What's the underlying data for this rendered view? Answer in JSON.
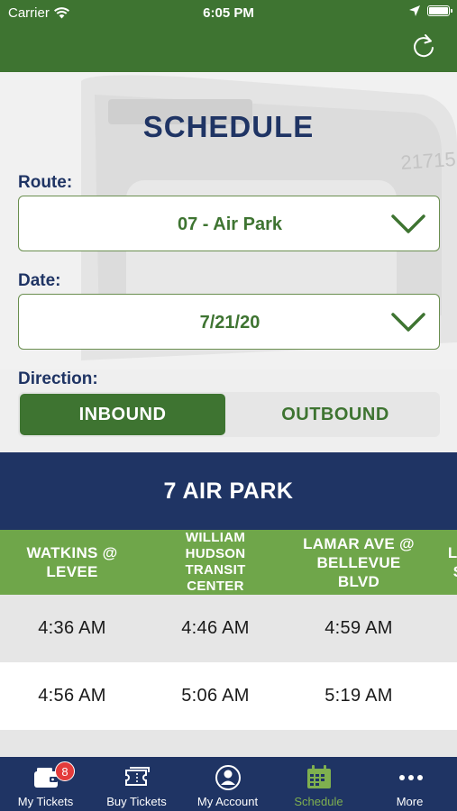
{
  "status_bar": {
    "carrier": "Carrier",
    "time": "6:05 PM"
  },
  "header": {
    "refresh_icon": "refresh-icon"
  },
  "page": {
    "title": "SCHEDULE"
  },
  "route": {
    "label": "Route:",
    "value": "07 - Air Park"
  },
  "date": {
    "label": "Date:",
    "value": "7/21/20"
  },
  "direction": {
    "label": "Direction:",
    "options": [
      "INBOUND",
      "OUTBOUND"
    ],
    "selected": "INBOUND"
  },
  "route_banner": "7 AIR PARK",
  "schedule": {
    "stops": [
      {
        "name": "WATKINS @ LEVEE"
      },
      {
        "name": "WILLIAM HUDSON TRANSIT CENTER"
      },
      {
        "name": "LAMAR AVE @ BELLEVUE BLVD"
      },
      {
        "name": "LA S"
      }
    ],
    "rows": [
      [
        "4:36 AM",
        "4:46 AM",
        "4:59 AM"
      ],
      [
        "4:56 AM",
        "5:06 AM",
        "5:19 AM"
      ]
    ]
  },
  "tabbar": {
    "items": [
      {
        "label": "My Tickets",
        "icon": "wallet-icon",
        "badge": "8"
      },
      {
        "label": "Buy Tickets",
        "icon": "tickets-icon"
      },
      {
        "label": "My Account",
        "icon": "account-icon"
      },
      {
        "label": "Schedule",
        "icon": "calendar-icon",
        "active": true
      },
      {
        "label": "More",
        "icon": "more-icon"
      }
    ]
  },
  "colors": {
    "green": "#3e7431",
    "light_green": "#6fa64a",
    "navy": "#1f3464",
    "active_tab": "#7fb04f"
  }
}
